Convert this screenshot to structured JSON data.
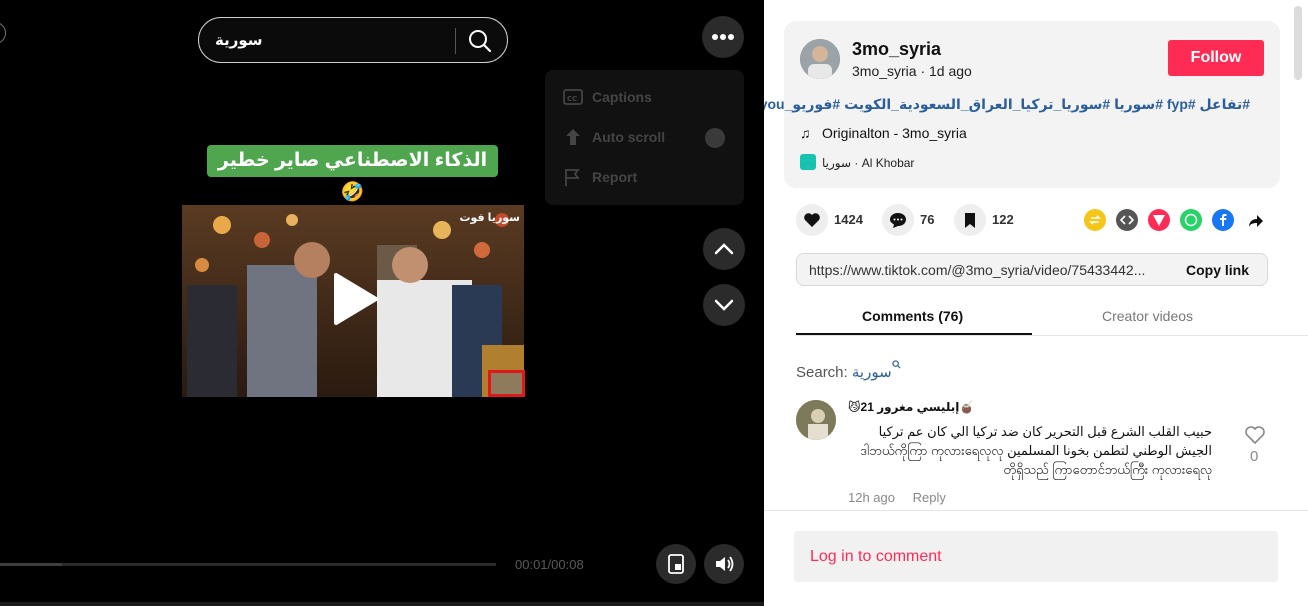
{
  "search": {
    "query": "سورية"
  },
  "menu": {
    "captions": "Captions",
    "auto_scroll": "Auto scroll",
    "report": "Report"
  },
  "video": {
    "caption_banner": "الذكاء الاصطناعي صاير خطير 🤣",
    "watermark": "سوريا فوت",
    "current_time": "00:01/00:08",
    "progress": 0.125
  },
  "post": {
    "username": "3mo_syria",
    "subline": "3mo_syria · 1d ago",
    "follow_label": "Follow",
    "hashtags": "#تفاعل #fyp #سوريا #سوريا_تركيا_العراق_السعودية_الكويت #فوريو_foryou",
    "music": "Originalton - 3mo_syria",
    "location": "سوريا · Al Khobar"
  },
  "stats": {
    "likes": "1424",
    "comments": "76",
    "saves": "122"
  },
  "share": {
    "link": "https://www.tiktok.com/@3mo_syria/video/75433442...",
    "copy_label": "Copy link"
  },
  "tabs": {
    "comments": "Comments (76)",
    "creator_videos": "Creator videos"
  },
  "comment_search": {
    "label": "Search:",
    "term": "سورية"
  },
  "comments": [
    {
      "name": "🧉إبليسي مغرور 21😼",
      "text": "حبيب القلب الشرع قبل التحرير كان ضد تركيا الي كان عم تركيا الجيش الوطني لتطمن بخونا المسلمين ဒါဘယ်ကိုကြာ ကုလားရေလုလုတိုရှိသည် ကြာတောင်ဘယ်ကြီး ကုလားရေလု",
      "time": "12h ago",
      "reply": "Reply",
      "likes": "0"
    }
  ],
  "login": {
    "label": "Log in to comment"
  },
  "colors": {
    "accent": "#fe2c55",
    "link": "#2b5e9e",
    "banner": "#4fa64f"
  }
}
